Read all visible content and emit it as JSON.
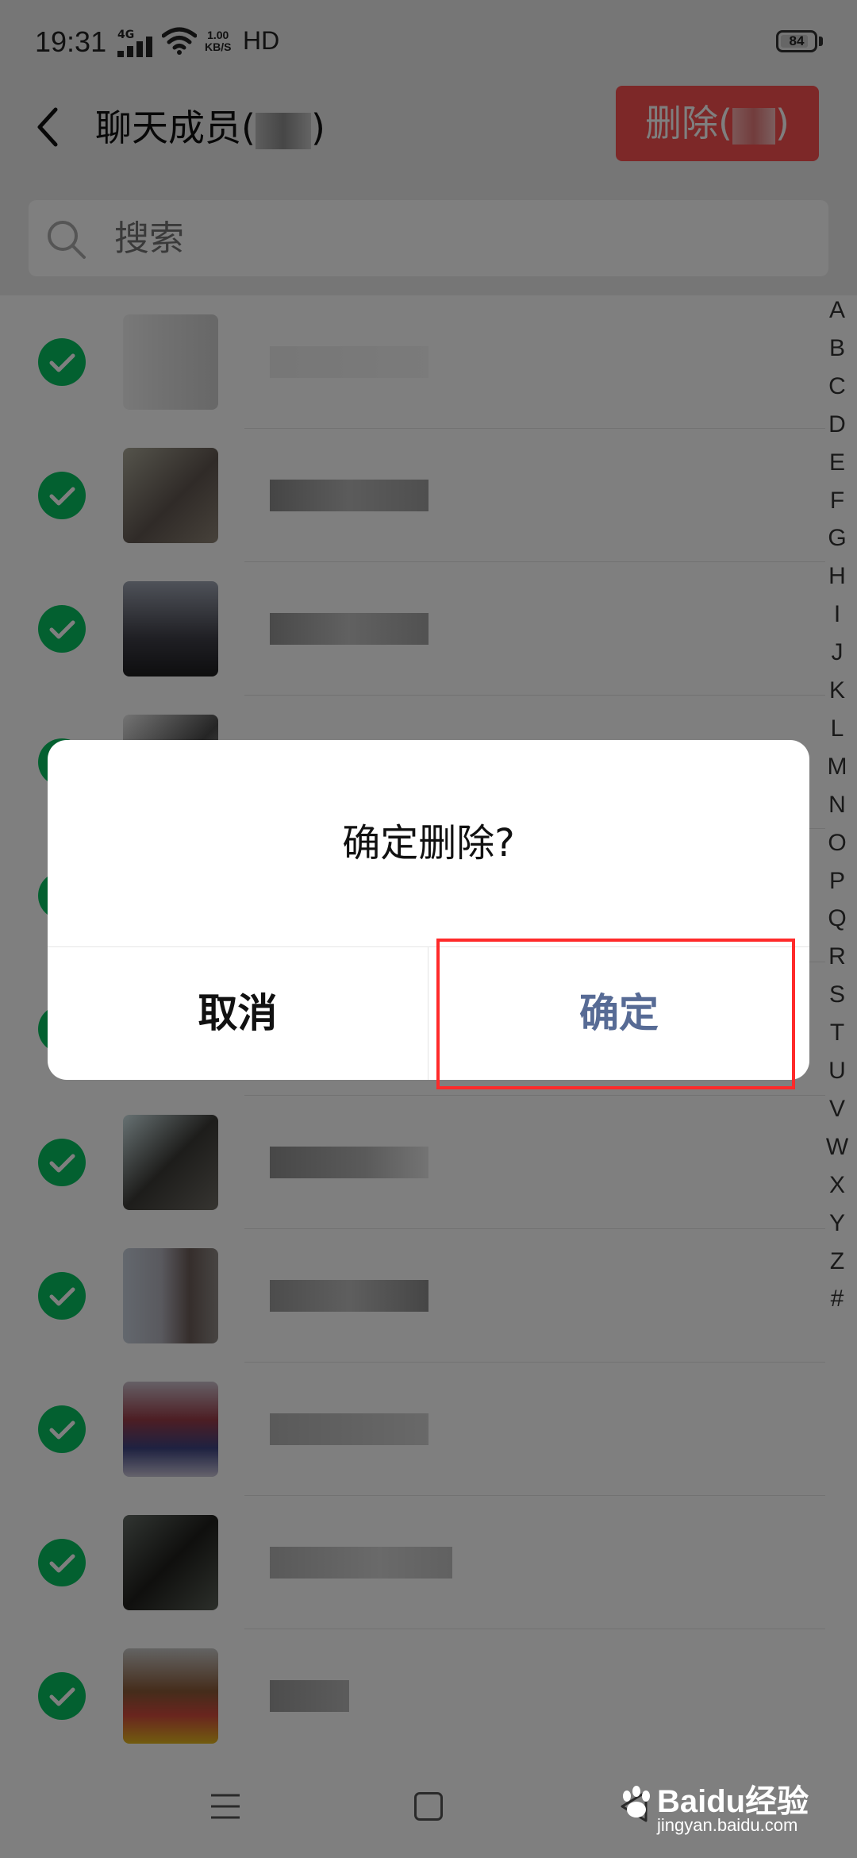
{
  "status_bar": {
    "time": "19:31",
    "network": "4G",
    "speed_value": "1.00",
    "speed_unit": "KB/S",
    "hd": "HD",
    "battery": "84",
    "battery_level": 0.84
  },
  "header": {
    "back_icon": "chevron-left-icon",
    "title": "聊天成员(",
    "title_close": ")",
    "delete_label": "删除(",
    "delete_close": ")",
    "delete_color": "#fa5151"
  },
  "search": {
    "placeholder": "搜索",
    "icon": "search-icon"
  },
  "members": [
    {
      "checked": true
    },
    {
      "checked": true
    },
    {
      "checked": true
    },
    {
      "checked": true
    },
    {
      "checked": true
    },
    {
      "checked": true
    },
    {
      "checked": true
    },
    {
      "checked": true
    },
    {
      "checked": true
    },
    {
      "checked": true
    },
    {
      "checked": true
    }
  ],
  "index_letters": [
    "A",
    "B",
    "C",
    "D",
    "E",
    "F",
    "G",
    "H",
    "I",
    "J",
    "K",
    "L",
    "M",
    "N",
    "O",
    "P",
    "Q",
    "R",
    "S",
    "T",
    "U",
    "V",
    "W",
    "X",
    "Y",
    "Z",
    "#"
  ],
  "dialog": {
    "message": "确定删除?",
    "cancel_label": "取消",
    "confirm_label": "确定",
    "confirm_color": "#576b95"
  },
  "nav_bar": {
    "menu_icon": "menu-icon",
    "home_icon": "home-square-icon",
    "back_icon": "back-triangle-icon"
  },
  "watermark": {
    "main": "Baidu经验",
    "sub": "jingyan.baidu.com"
  },
  "colors": {
    "check_green": "#07c160",
    "highlight_red": "#ff2a2a"
  }
}
